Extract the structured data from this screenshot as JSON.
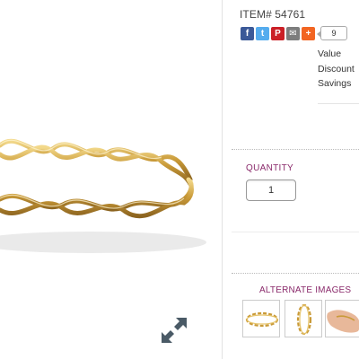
{
  "product": {
    "item_number": "ITEM# 54761"
  },
  "share": {
    "buttons": [
      {
        "name": "facebook",
        "glyph": "f",
        "color": "#3b5998"
      },
      {
        "name": "twitter",
        "glyph": "t",
        "color": "#55acee"
      },
      {
        "name": "pinterest",
        "glyph": "P",
        "color": "#cb2027"
      },
      {
        "name": "email",
        "glyph": "✉",
        "color": "#7d7d7d"
      },
      {
        "name": "more",
        "glyph": "+",
        "color": "#f26522"
      }
    ],
    "count": "9"
  },
  "pricing": {
    "labels": [
      "Value",
      "Discount",
      "Savings"
    ]
  },
  "quantity": {
    "label": "QUANTITY",
    "value": "1"
  },
  "alternate_images": {
    "title": "ALTERNATE IMAGES",
    "thumbnails": [
      "ring-front-view",
      "ring-side-view",
      "ring-on-hand"
    ]
  },
  "colors": {
    "accent": "#8a2a6b",
    "gold": "#d4a742"
  }
}
